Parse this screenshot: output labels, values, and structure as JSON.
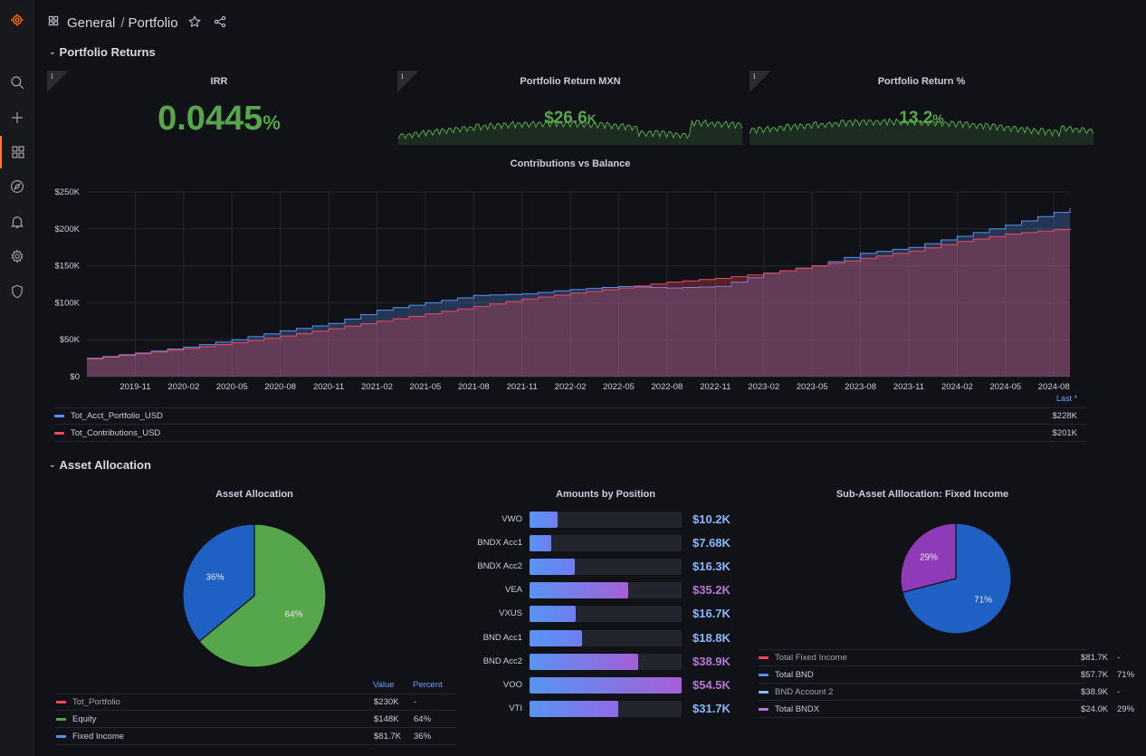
{
  "breadcrumb": {
    "folder": "General",
    "separator": "/",
    "page": "Portfolio"
  },
  "sidebar": {
    "items": [
      "grafana-logo",
      "search",
      "create",
      "dashboards",
      "explore",
      "alerting",
      "configuration",
      "server-admin"
    ]
  },
  "rows": {
    "returns": "Portfolio Returns",
    "allocation": "Asset Allocation"
  },
  "stats": {
    "irr": {
      "title": "IRR",
      "value": "0.0445",
      "unit": "%"
    },
    "return_mxn": {
      "title": "Portfolio Return MXN",
      "value": "$26.6",
      "unit": "K"
    },
    "return_pct": {
      "title": "Portfolio Return %",
      "value": "13.2",
      "unit": "%"
    }
  },
  "info_glyph": "i",
  "timeseries": {
    "title": "Contributions vs Balance",
    "legend_header": "Last *",
    "legend": [
      {
        "name": "Tot_Acct_Portfolio_USD",
        "last": "$228K",
        "color": "#5794f2"
      },
      {
        "name": "Tot_Contributions_USD",
        "last": "$201K",
        "color": "#f2495c"
      }
    ]
  },
  "pie1": {
    "title": "Asset Allocation",
    "headers": {
      "value": "Value",
      "percent": "Percent"
    },
    "rows": [
      {
        "name": "Tot_Portfolio",
        "value": "$230K",
        "percent": "-",
        "color": "#f2495c"
      },
      {
        "name": "Equity",
        "value": "$148K",
        "percent": "64%",
        "color": "#56a64b"
      },
      {
        "name": "Fixed Income",
        "value": "$81.7K",
        "percent": "36%",
        "color": "#5794f2"
      }
    ]
  },
  "bars": {
    "title": "Amounts by Position",
    "items": [
      {
        "label": "VWO",
        "value": "$10.2K"
      },
      {
        "label": "BNDX Acc1",
        "value": "$7.68K"
      },
      {
        "label": "BNDX Acc2",
        "value": "$16.3K"
      },
      {
        "label": "VEA",
        "value": "$35.2K"
      },
      {
        "label": "VXUS",
        "value": "$16.7K"
      },
      {
        "label": "BND Acc1",
        "value": "$18.8K"
      },
      {
        "label": "BND Acc2",
        "value": "$38.9K"
      },
      {
        "label": "VOO",
        "value": "$54.5K"
      },
      {
        "label": "VTI",
        "value": "$31.7K"
      }
    ]
  },
  "pie2": {
    "title": "Sub-Asset Alllocation: Fixed Income",
    "rows": [
      {
        "name": "Total Fixed Income",
        "value": "$81.7K",
        "percent": "-",
        "color": "#f2495c"
      },
      {
        "name": "Total BND",
        "value": "$57.7K",
        "percent": "71%",
        "color": "#5794f2"
      },
      {
        "name": "BND Account 2",
        "value": "$38.9K",
        "percent": "-",
        "color": "#8ab8ff"
      },
      {
        "name": "Total BNDX",
        "value": "$24.0K",
        "percent": "29%",
        "color": "#b877d9"
      }
    ]
  },
  "chart_data": [
    {
      "type": "area",
      "title": "Contributions vs Balance",
      "x_ticks": [
        "2019-11",
        "2020-02",
        "2020-05",
        "2020-08",
        "2020-11",
        "2021-02",
        "2021-05",
        "2021-08",
        "2021-11",
        "2022-02",
        "2022-05",
        "2022-08",
        "2022-11",
        "2023-02",
        "2023-05",
        "2023-08",
        "2023-11",
        "2024-02",
        "2024-05",
        "2024-08"
      ],
      "y_ticks": [
        "$0",
        "$50K",
        "$100K",
        "$150K",
        "$200K",
        "$250K"
      ],
      "ylim": [
        0,
        250000
      ],
      "x_range": [
        "2019-08",
        "2024-09"
      ],
      "grid": true,
      "legend_position": "bottom",
      "series": [
        {
          "name": "Tot_Acct_Portfolio_USD",
          "color": "#5794f2",
          "x": [
            "2019-08",
            "2019-11",
            "2020-02",
            "2020-05",
            "2020-08",
            "2020-11",
            "2021-02",
            "2021-05",
            "2021-08",
            "2021-11",
            "2022-02",
            "2022-05",
            "2022-08",
            "2022-11",
            "2023-02",
            "2023-05",
            "2023-08",
            "2023-11",
            "2024-02",
            "2024-05",
            "2024-09"
          ],
          "values": [
            25000,
            32000,
            40000,
            50000,
            62000,
            72000,
            90000,
            100000,
            110000,
            112000,
            118000,
            122000,
            120000,
            122000,
            140000,
            150000,
            167000,
            175000,
            190000,
            205000,
            228000
          ]
        },
        {
          "name": "Tot_Contributions_USD",
          "color": "#f2495c",
          "x": [
            "2019-08",
            "2019-11",
            "2020-02",
            "2020-05",
            "2020-08",
            "2020-11",
            "2021-02",
            "2021-05",
            "2021-08",
            "2021-11",
            "2022-02",
            "2022-05",
            "2022-08",
            "2022-11",
            "2023-02",
            "2023-05",
            "2023-08",
            "2023-11",
            "2024-02",
            "2024-05",
            "2024-09"
          ],
          "values": [
            24000,
            31000,
            38000,
            46000,
            55000,
            65000,
            75000,
            85000,
            95000,
            105000,
            113000,
            120000,
            128000,
            133000,
            140000,
            150000,
            160000,
            170000,
            183000,
            193000,
            201000
          ]
        }
      ]
    },
    {
      "type": "pie",
      "title": "Asset Allocation",
      "categories": [
        "Equity",
        "Fixed Income"
      ],
      "values": [
        64,
        36
      ],
      "colors": [
        "#56a64b",
        "#1f60c4"
      ]
    },
    {
      "type": "bar",
      "title": "Amounts by Position",
      "categories": [
        "VWO",
        "BNDX Acc1",
        "BNDX Acc2",
        "VEA",
        "VXUS",
        "BND Acc1",
        "BND Acc2",
        "VOO",
        "VTI"
      ],
      "values": [
        10.2,
        7.68,
        16.3,
        35.2,
        16.7,
        18.8,
        38.9,
        54.5,
        31.7
      ],
      "max": 54.5
    },
    {
      "type": "pie",
      "title": "Sub-Asset Alllocation: Fixed Income",
      "categories": [
        "Total BND",
        "Total BNDX"
      ],
      "values": [
        71,
        29
      ],
      "colors": [
        "#1f60c4",
        "#8f3bb8"
      ]
    }
  ]
}
